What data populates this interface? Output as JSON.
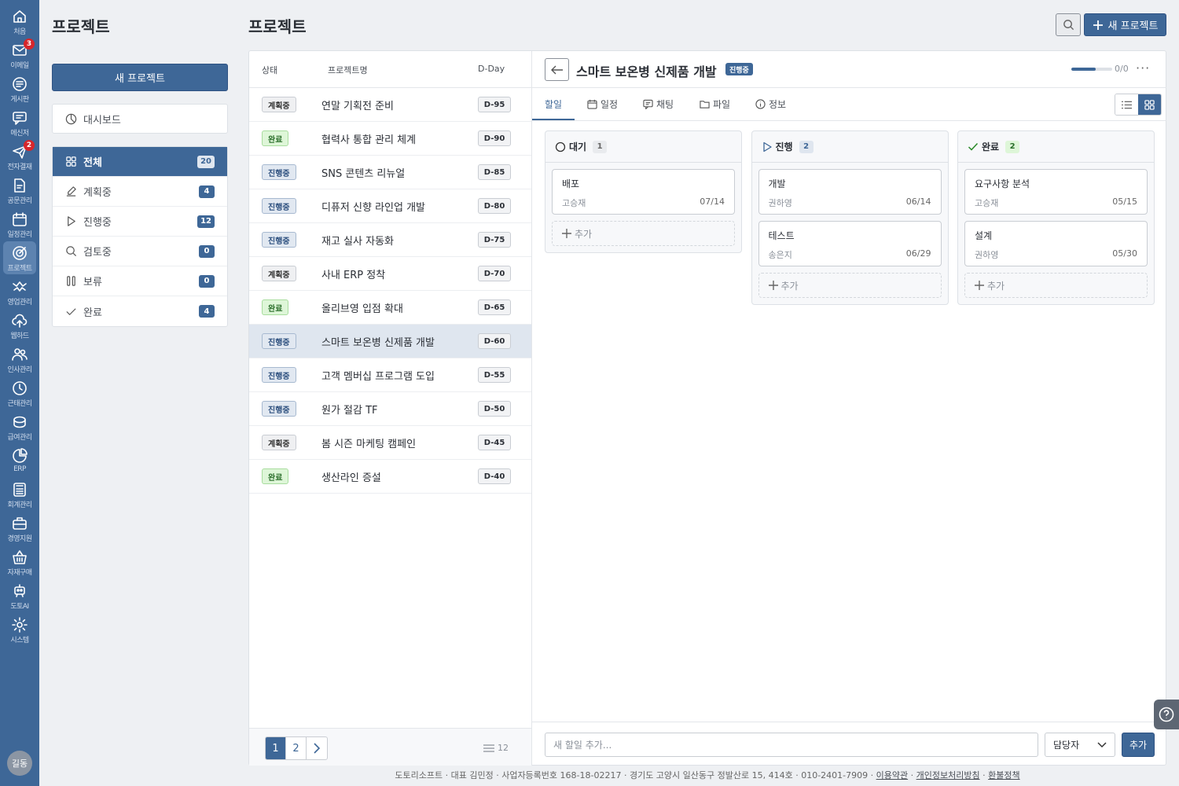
{
  "nav": [
    {
      "label": "처음",
      "icon": "home-icon",
      "badge": ""
    },
    {
      "label": "이메일",
      "icon": "mail-icon",
      "badge": "3"
    },
    {
      "label": "게시판",
      "icon": "board-icon",
      "badge": ""
    },
    {
      "label": "메신저",
      "icon": "messenger-icon",
      "badge": ""
    },
    {
      "label": "전자결재",
      "icon": "approval-icon",
      "badge": "2"
    },
    {
      "label": "공문관리",
      "icon": "document-icon",
      "badge": ""
    },
    {
      "label": "일정관리",
      "icon": "calendar-icon",
      "badge": ""
    },
    {
      "label": "프로젝트",
      "icon": "project-icon",
      "badge": ""
    },
    {
      "label": "영업관리",
      "icon": "sales-icon",
      "badge": ""
    },
    {
      "label": "웹하드",
      "icon": "cloud-icon",
      "badge": ""
    },
    {
      "label": "인사관리",
      "icon": "people-icon",
      "badge": ""
    },
    {
      "label": "근태관리",
      "icon": "clock-icon",
      "badge": ""
    },
    {
      "label": "급여관리",
      "icon": "coin-icon",
      "badge": ""
    },
    {
      "label": "ERP",
      "icon": "pie-icon",
      "badge": ""
    },
    {
      "label": "회계관리",
      "icon": "calculator-icon",
      "badge": ""
    },
    {
      "label": "경영지원",
      "icon": "briefcase-icon",
      "badge": ""
    },
    {
      "label": "자재구매",
      "icon": "basket-icon",
      "badge": ""
    },
    {
      "label": "도토AI",
      "icon": "robot-icon",
      "badge": ""
    },
    {
      "label": "시스템",
      "icon": "gear-icon",
      "badge": ""
    }
  ],
  "user": {
    "avatar": "길동"
  },
  "sidebar": {
    "title": "프로젝트",
    "new_button": "새 프로젝트",
    "dashboard": "대시보드",
    "filters": [
      {
        "label": "전체",
        "count": "20"
      },
      {
        "label": "계획중",
        "count": "4"
      },
      {
        "label": "진행중",
        "count": "12"
      },
      {
        "label": "검토중",
        "count": "0"
      },
      {
        "label": "보류",
        "count": "0"
      },
      {
        "label": "완료",
        "count": "4"
      }
    ]
  },
  "header": {
    "title": "프로젝트",
    "new_button": "새 프로젝트"
  },
  "list": {
    "columns": {
      "status": "상태",
      "name": "프로젝트명",
      "dday": "D-Day"
    },
    "rows": [
      {
        "status": "계획중",
        "name": "연말 기획전 준비",
        "dday": "D-95"
      },
      {
        "status": "완료",
        "name": "협력사 통합 관리 체계",
        "dday": "D-90"
      },
      {
        "status": "진행중",
        "name": "SNS 콘텐츠 리뉴얼",
        "dday": "D-85"
      },
      {
        "status": "진행중",
        "name": "디퓨저 신향 라인업 개발",
        "dday": "D-80"
      },
      {
        "status": "진행중",
        "name": "재고 실사 자동화",
        "dday": "D-75"
      },
      {
        "status": "계획중",
        "name": "사내 ERP 정착",
        "dday": "D-70"
      },
      {
        "status": "완료",
        "name": "올리브영 입점 확대",
        "dday": "D-65"
      },
      {
        "status": "진행중",
        "name": "스마트 보온병 신제품 개발",
        "dday": "D-60"
      },
      {
        "status": "진행중",
        "name": "고객 멤버십 프로그램 도입",
        "dday": "D-55"
      },
      {
        "status": "진행중",
        "name": "원가 절감 TF",
        "dday": "D-50"
      },
      {
        "status": "계획중",
        "name": "봄 시즌 마케팅 캠페인",
        "dday": "D-45"
      },
      {
        "status": "완료",
        "name": "생산라인 증설",
        "dday": "D-40"
      }
    ],
    "pages": [
      "1",
      "2"
    ],
    "total": "12"
  },
  "detail": {
    "title": "스마트 보온병 신제품 개발",
    "status": "진행중",
    "progress_text": "0/0",
    "progress": 0.6,
    "tabs": [
      "할일",
      "일정",
      "채팅",
      "파일",
      "정보"
    ],
    "columns": [
      {
        "title": "대기",
        "count": "1",
        "cards": [
          {
            "title": "배포",
            "assignee": "고승재",
            "date": "07/14"
          }
        ]
      },
      {
        "title": "진행",
        "count": "2",
        "cards": [
          {
            "title": "개발",
            "assignee": "권하영",
            "date": "06/14"
          },
          {
            "title": "테스트",
            "assignee": "송은지",
            "date": "06/29"
          }
        ]
      },
      {
        "title": "완료",
        "count": "2",
        "cards": [
          {
            "title": "요구사항 분석",
            "assignee": "고승재",
            "date": "05/15"
          },
          {
            "title": "설계",
            "assignee": "권하영",
            "date": "05/30"
          }
        ]
      }
    ],
    "add_label": "추가",
    "todo_placeholder": "새 할일 추가...",
    "assignee_label": "담당자",
    "add_button": "추가"
  },
  "footer": {
    "text": "도토리소프트 · 대표 김민정 · 사업자등록번호 168-18-02217 · 경기도 고양시 일산동구 정발산로 15, 414호 · 010-2401-7909 ·",
    "links": [
      "이용약관",
      "개인정보처리방침",
      "환불정책"
    ],
    "sep": "·"
  }
}
